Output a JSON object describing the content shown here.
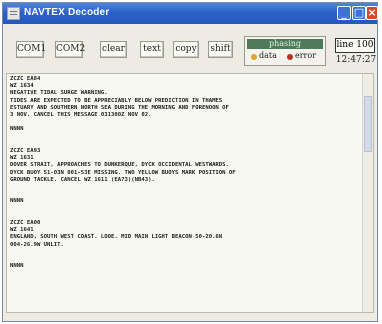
{
  "window": {
    "title": "NAVTEX Decoder"
  },
  "titlebar_controls": {
    "minimize": "_",
    "maximize": "□",
    "close": "×"
  },
  "toolbar": {
    "buttons": [
      "COM1",
      "COM2",
      "clear",
      "text",
      "copy",
      "shift"
    ],
    "status": {
      "phase": "phasing",
      "data_label": "data",
      "error_label": "error"
    },
    "line_label": "line 100",
    "time": "12:47:27"
  },
  "colors": {
    "titlebar": "#2b61c7",
    "phase_bar": "#4d7a5a",
    "data_led": "#e0a42b",
    "error_led": "#b33222"
  },
  "messages_text": "ZCZC EA84\nWZ 1634\nNEGATIVE TIDAL SURGE WARNING.\nTIDES ARE EXPECTED TO BE APPRECIABLY BELOW PREDICTION IN THAMES\nESTUARY AND SOUTHERN NORTH SEA DURING THE MORNING AND FORENOON OF\n3 NOV. CANCEL THIS MESSAGE 031300Z NOV 02.\n\nNNNN\n\n\nZCZC EA93\nWZ 1631\nDOVER STRAIT, APPROACHES TO DUNKERQUE, DYCK OCCIDENTAL WESTWARDS.\nDYCK BUOY 51-03N 001-53E MISSING. TWO YELLOW BUOYS MARK POSITION OF\nGROUND TACKLE. CANCEL WZ 1611 (EA73)(NB43).\n\n\nNNNN\n\n\nZCZC EA00\nWZ 1641\nENGLAND, SOUTH WEST COAST. LOOE. MID MAIN LIGHT BEACON 50-20.6N\n004-26.9W UNLIT.\n\n\nNNNN"
}
